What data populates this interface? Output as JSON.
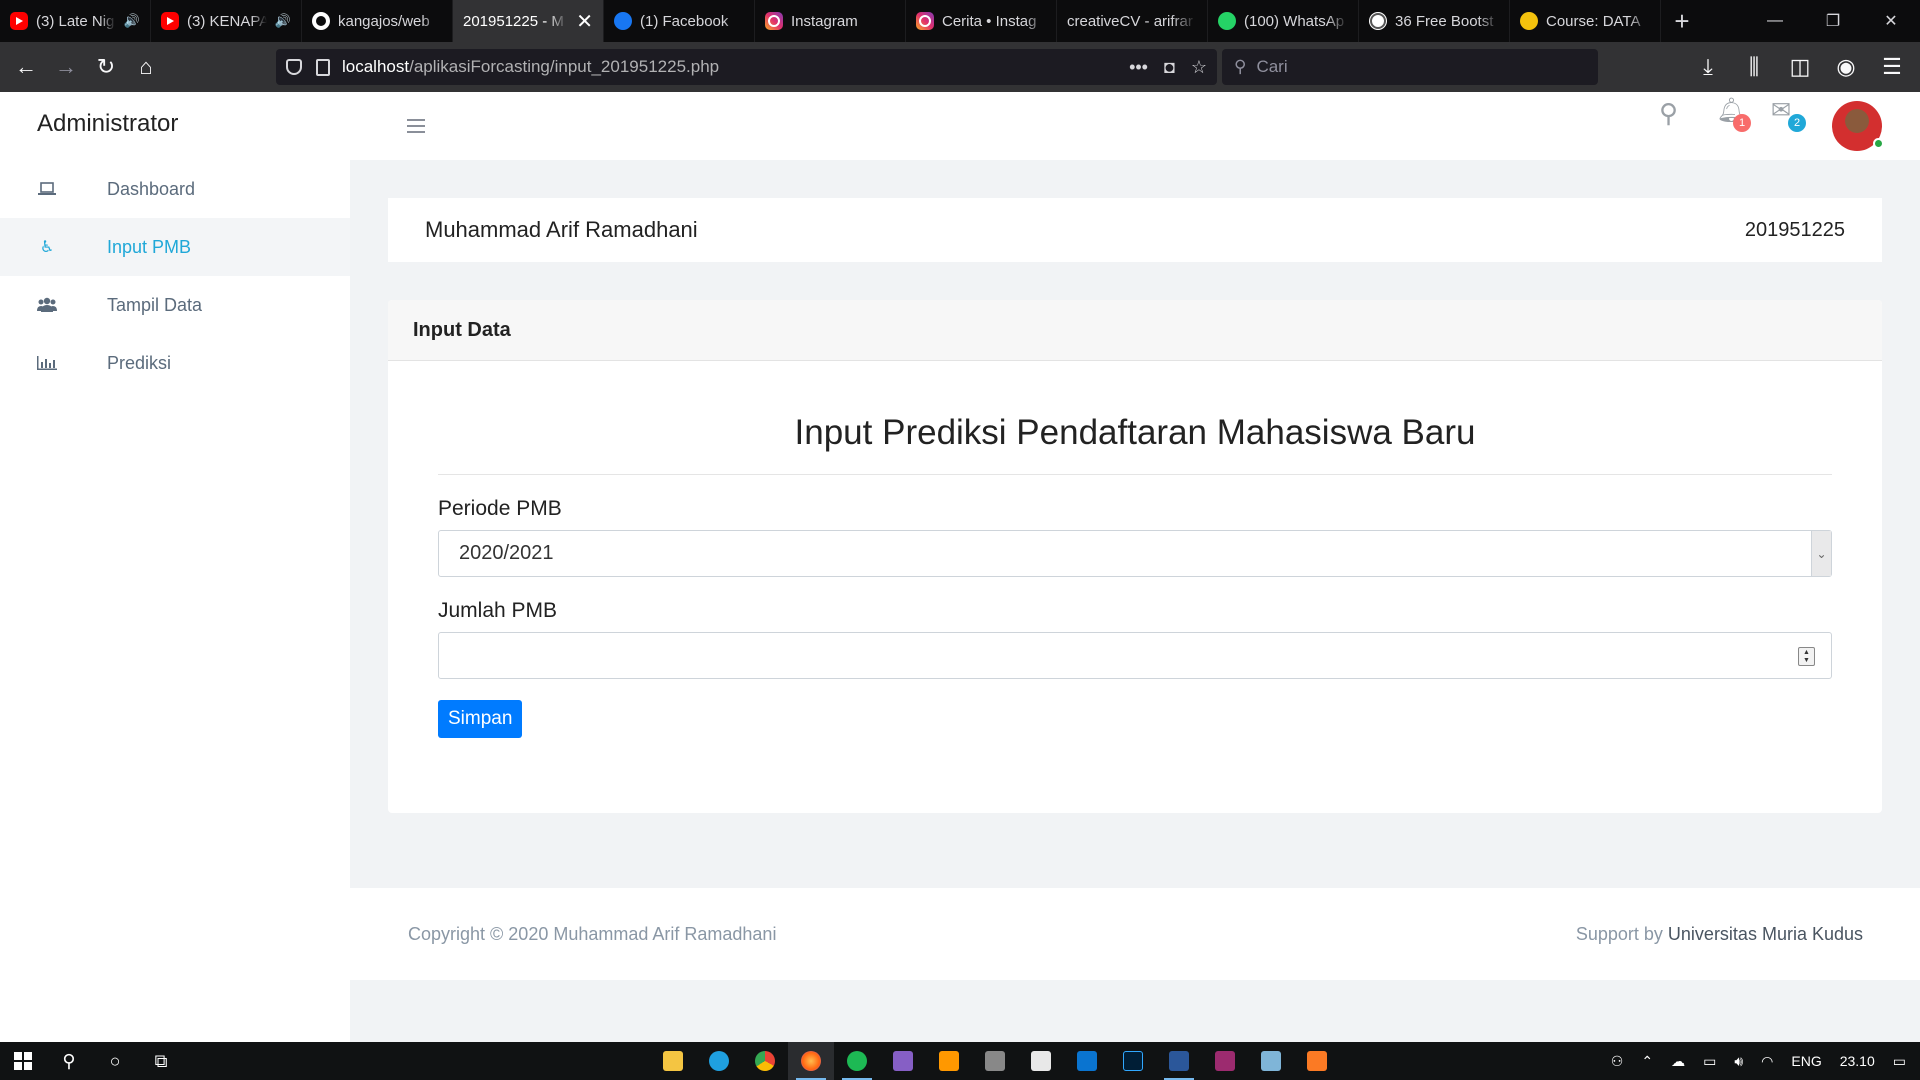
{
  "browser": {
    "tabs": [
      {
        "label": "(3) Late Nig",
        "icon": "youtube-icon",
        "audio": true
      },
      {
        "label": "(3) KENAPA",
        "icon": "youtube-icon",
        "audio": true
      },
      {
        "label": "kangajos/web",
        "icon": "github-icon"
      },
      {
        "label": "201951225 - M",
        "icon": "none",
        "active": true
      },
      {
        "label": "(1) Facebook",
        "icon": "facebook-icon"
      },
      {
        "label": "Instagram",
        "icon": "instagram-icon"
      },
      {
        "label": "Cerita • Instag",
        "icon": "instagram-icon"
      },
      {
        "label": "creativeCV - arifrar",
        "icon": "none"
      },
      {
        "label": "(100) WhatsAp",
        "icon": "whatsapp-icon"
      },
      {
        "label": "36 Free Bootst",
        "icon": "wordpress-icon"
      },
      {
        "label": "Course: DATA",
        "icon": "course-icon"
      }
    ],
    "url_host": "localhost",
    "url_path": "/aplikasiForcasting/input_201951225.php",
    "search_placeholder": "Cari"
  },
  "header": {
    "brand": "Administrator",
    "notifications_count": "1",
    "messages_count": "2"
  },
  "sidebar": {
    "items": [
      {
        "label": "Dashboard",
        "icon": "laptop-icon",
        "active": false
      },
      {
        "label": "Input PMB",
        "icon": "wheelchair-icon",
        "active": true
      },
      {
        "label": "Tampil Data",
        "icon": "users-icon",
        "active": false
      },
      {
        "label": "Prediksi",
        "icon": "bar-chart-icon",
        "active": false
      }
    ]
  },
  "userbar": {
    "name": "Muhammad Arif Ramadhani",
    "nim": "201951225"
  },
  "card": {
    "header": "Input Data",
    "form_title": "Input Prediksi Pendaftaran Mahasiswa Baru",
    "periode_label": "Periode PMB",
    "periode_value": "2020/2021",
    "jumlah_label": "Jumlah PMB",
    "jumlah_value": "",
    "submit_label": "Simpan"
  },
  "footer": {
    "copyright": "Copyright © 2020 Muhammad Arif Ramadhani",
    "support_prefix": "Support by",
    "support_name": "Universitas Muria Kudus"
  },
  "taskbar": {
    "language": "ENG",
    "time": "23.10"
  },
  "colors": {
    "accent": "#20a8d8",
    "primary_button": "#007bff",
    "badge_red": "#f86c6b",
    "badge_blue": "#20a8d8"
  }
}
